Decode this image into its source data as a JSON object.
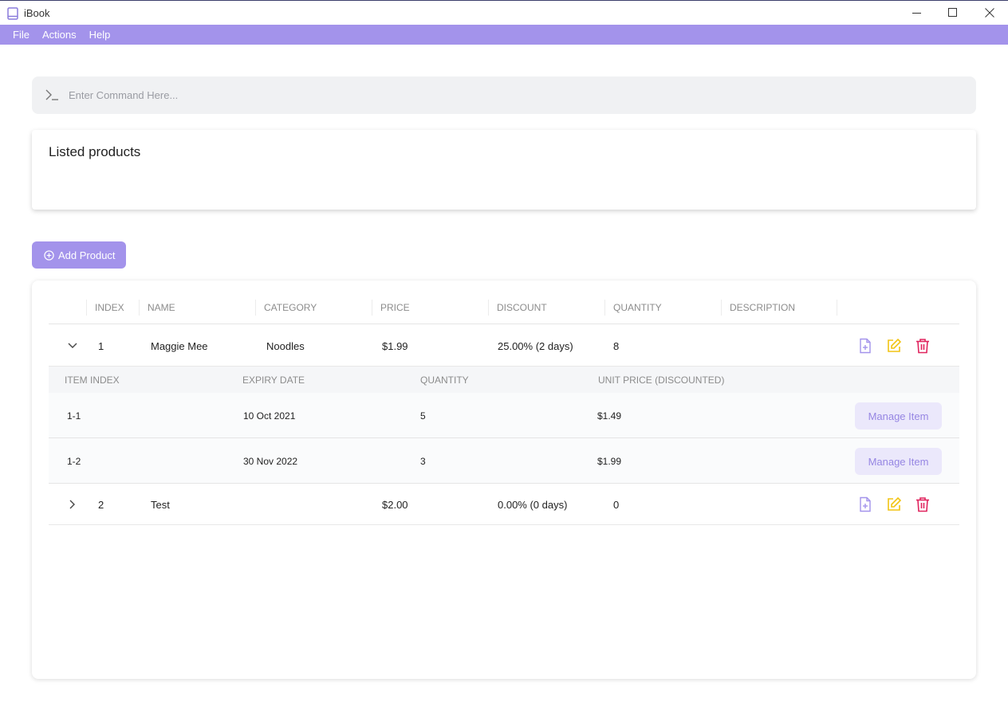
{
  "window": {
    "title": "iBook"
  },
  "menu": {
    "file": "File",
    "actions": "Actions",
    "help": "Help"
  },
  "command": {
    "placeholder": "Enter Command Here...",
    "value": ""
  },
  "result": {
    "text": "Listed products"
  },
  "add_button": {
    "label": "Add Product"
  },
  "table": {
    "headers": [
      "INDEX",
      "NAME",
      "CATEGORY",
      "PRICE",
      "DISCOUNT",
      "QUANTITY",
      "DESCRIPTION"
    ],
    "products": [
      {
        "index": "1",
        "name": "Maggie Mee",
        "category": "Noodles",
        "price": "$1.99",
        "discount": "25.00% (2 days)",
        "quantity": "8",
        "description": "",
        "expanded": true
      },
      {
        "index": "2",
        "name": "Test",
        "category": "",
        "price": "$2.00",
        "discount": "0.00% (0 days)",
        "quantity": "0",
        "description": "",
        "expanded": false
      }
    ],
    "item_headers": [
      "ITEM INDEX",
      "EXPIRY DATE",
      "QUANTITY",
      "UNIT PRICE (DISCOUNTED)"
    ],
    "items": [
      {
        "index": "1-1",
        "expiry": "10 Oct 2021",
        "quantity": "5",
        "unit_price": "$1.49",
        "action": "Manage Item"
      },
      {
        "index": "1-2",
        "expiry": "30 Nov 2022",
        "quantity": "3",
        "unit_price": "$1.99",
        "action": "Manage Item"
      }
    ]
  },
  "colors": {
    "accent": "#a393eb",
    "edit": "#f2c413",
    "delete": "#e0245e"
  },
  "icons": {
    "app": "book-icon",
    "prompt": "terminal-prompt-icon",
    "add": "plus-circle-icon",
    "details": "file-plus-icon",
    "edit": "edit-icon",
    "delete": "trash-icon",
    "expand": "chevron-right-icon",
    "collapse": "chevron-down-icon"
  }
}
